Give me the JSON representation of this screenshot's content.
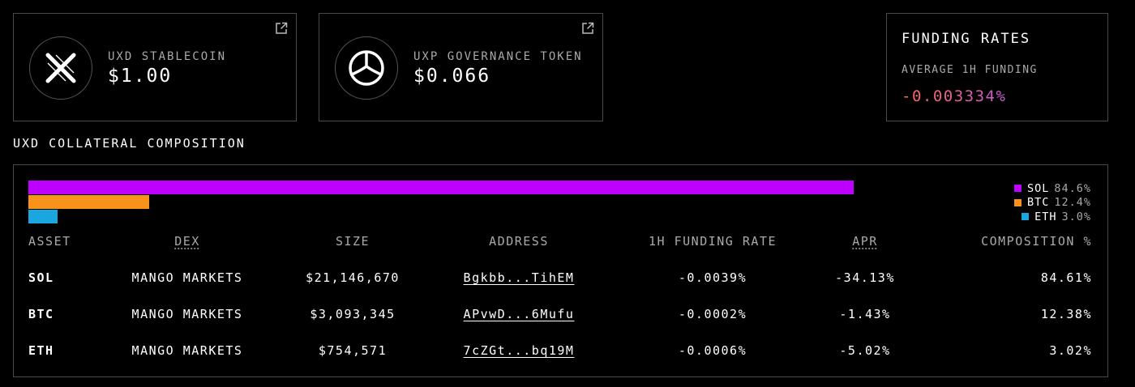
{
  "tokens": [
    {
      "label": "UXD STABLECOIN",
      "price": "$1.00",
      "icon": "uxd-logo-icon"
    },
    {
      "label": "UXP GOVERNANCE TOKEN",
      "price": "$0.066",
      "icon": "uxp-logo-icon"
    }
  ],
  "funding": {
    "title": "FUNDING RATES",
    "label": "AVERAGE 1H FUNDING",
    "value": "-0.003334%"
  },
  "composition": {
    "title": "UXD COLLATERAL COMPOSITION",
    "bars": [
      {
        "asset": "SOL",
        "percent": 84.6,
        "color": "#bd00ff"
      },
      {
        "asset": "BTC",
        "percent": 12.4,
        "color": "#f7931a"
      },
      {
        "asset": "ETH",
        "percent": 3.0,
        "color": "#1aa7e0"
      }
    ],
    "legend": [
      {
        "name": "SOL",
        "value": "84.6%",
        "color": "#bd00ff"
      },
      {
        "name": "BTC",
        "value": "12.4%",
        "color": "#f7931a"
      },
      {
        "name": "ETH",
        "value": "3.0%",
        "color": "#1aa7e0"
      }
    ],
    "columns": [
      "ASSET",
      "DEX",
      "SIZE",
      "ADDRESS",
      "1H FUNDING RATE",
      "APR",
      "COMPOSITION %"
    ],
    "rows": [
      {
        "asset": "SOL",
        "dex": "MANGO MARKETS",
        "size": "$21,146,670",
        "address": "Bgkbb...TihEM",
        "funding": "-0.0039%",
        "apr": "-34.13%",
        "composition": "84.61%"
      },
      {
        "asset": "BTC",
        "dex": "MANGO MARKETS",
        "size": "$3,093,345",
        "address": "APvwD...6Mufu",
        "funding": "-0.0002%",
        "apr": "-1.43%",
        "composition": "12.38%"
      },
      {
        "asset": "ETH",
        "dex": "MANGO MARKETS",
        "size": "$754,571",
        "address": "7cZGt...bq19M",
        "funding": "-0.0006%",
        "apr": "-5.02%",
        "composition": "3.02%"
      }
    ]
  }
}
